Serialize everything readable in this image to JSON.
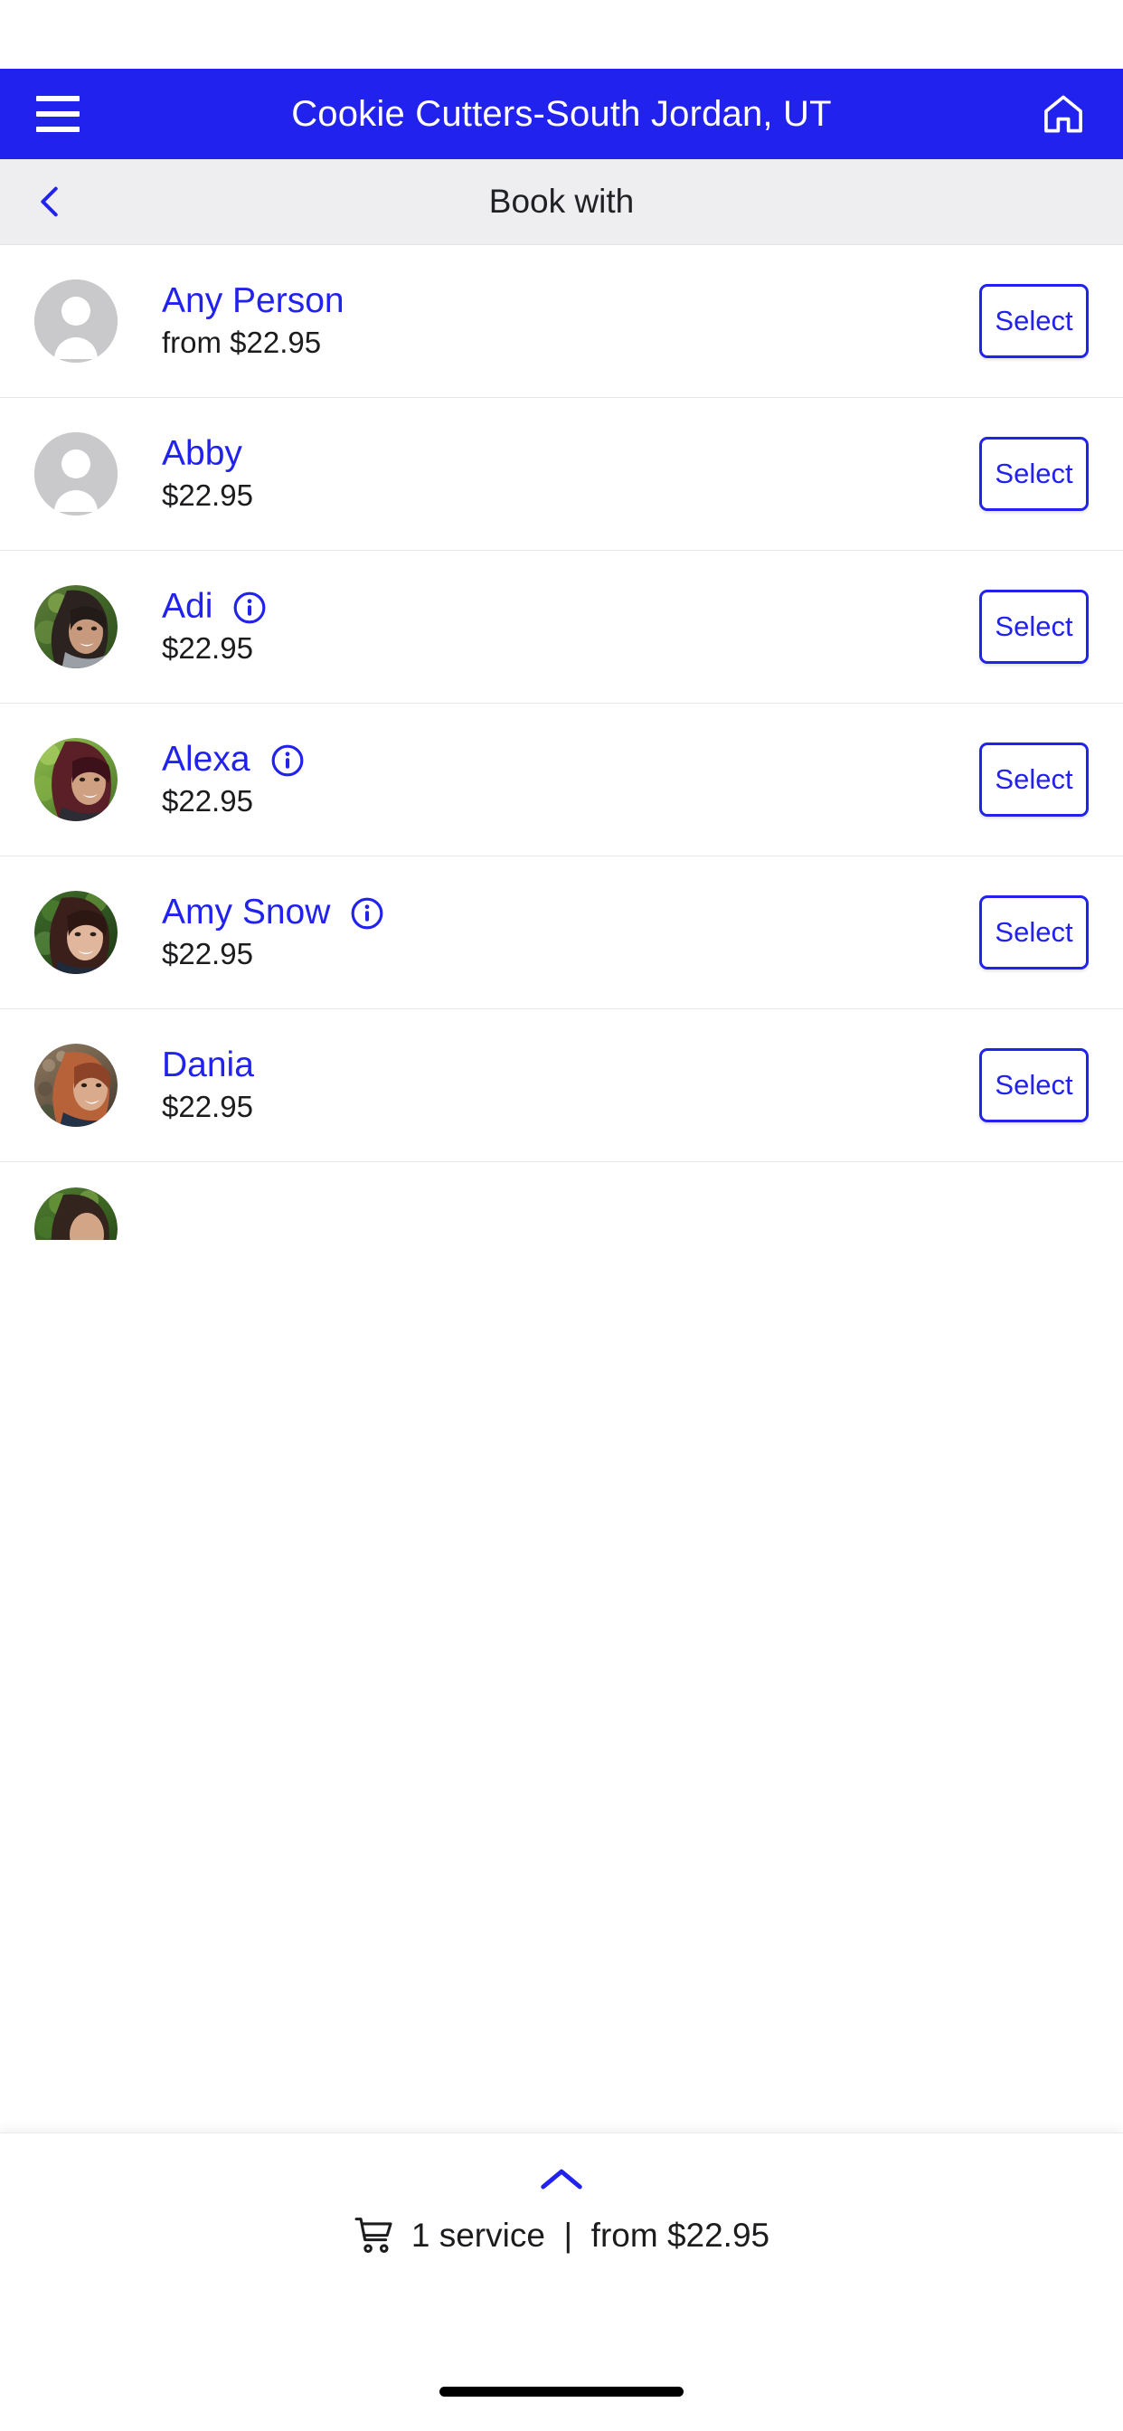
{
  "app_bar": {
    "menu_icon": "hamburger-icon",
    "title": "Cookie Cutters-South Jordan, UT",
    "home_icon": "home-icon"
  },
  "sub_header": {
    "back_icon": "chevron-left-icon",
    "title": "Book with"
  },
  "colors": {
    "brand_blue": "#2222EE",
    "header_bg": "#2222EE",
    "subheader_bg": "#EEEEF0",
    "text_dark": "#1C1C1E",
    "divider": "#E6E6E9",
    "avatar_placeholder": "#C9C9CC"
  },
  "staff_list": [
    {
      "name": "Any Person",
      "price": "from $22.95",
      "has_info": false,
      "avatar_type": "placeholder",
      "select_label": "Select"
    },
    {
      "name": "Abby",
      "price": "$22.95",
      "has_info": false,
      "avatar_type": "placeholder",
      "select_label": "Select"
    },
    {
      "name": "Adi",
      "price": "$22.95",
      "has_info": true,
      "avatar_type": "photo",
      "select_label": "Select"
    },
    {
      "name": "Alexa",
      "price": "$22.95",
      "has_info": true,
      "avatar_type": "photo",
      "select_label": "Select"
    },
    {
      "name": "Amy Snow",
      "price": "$22.95",
      "has_info": true,
      "avatar_type": "photo",
      "select_label": "Select"
    },
    {
      "name": "Dania",
      "price": "$22.95",
      "has_info": false,
      "avatar_type": "photo",
      "select_label": "Select"
    },
    {
      "name": "",
      "price": "",
      "has_info": false,
      "avatar_type": "photo",
      "select_label": ""
    }
  ],
  "bottom_bar": {
    "expand_icon": "chevron-up-icon",
    "cart_icon": "shopping-cart-icon",
    "summary": "1 service  |  from $22.95"
  }
}
